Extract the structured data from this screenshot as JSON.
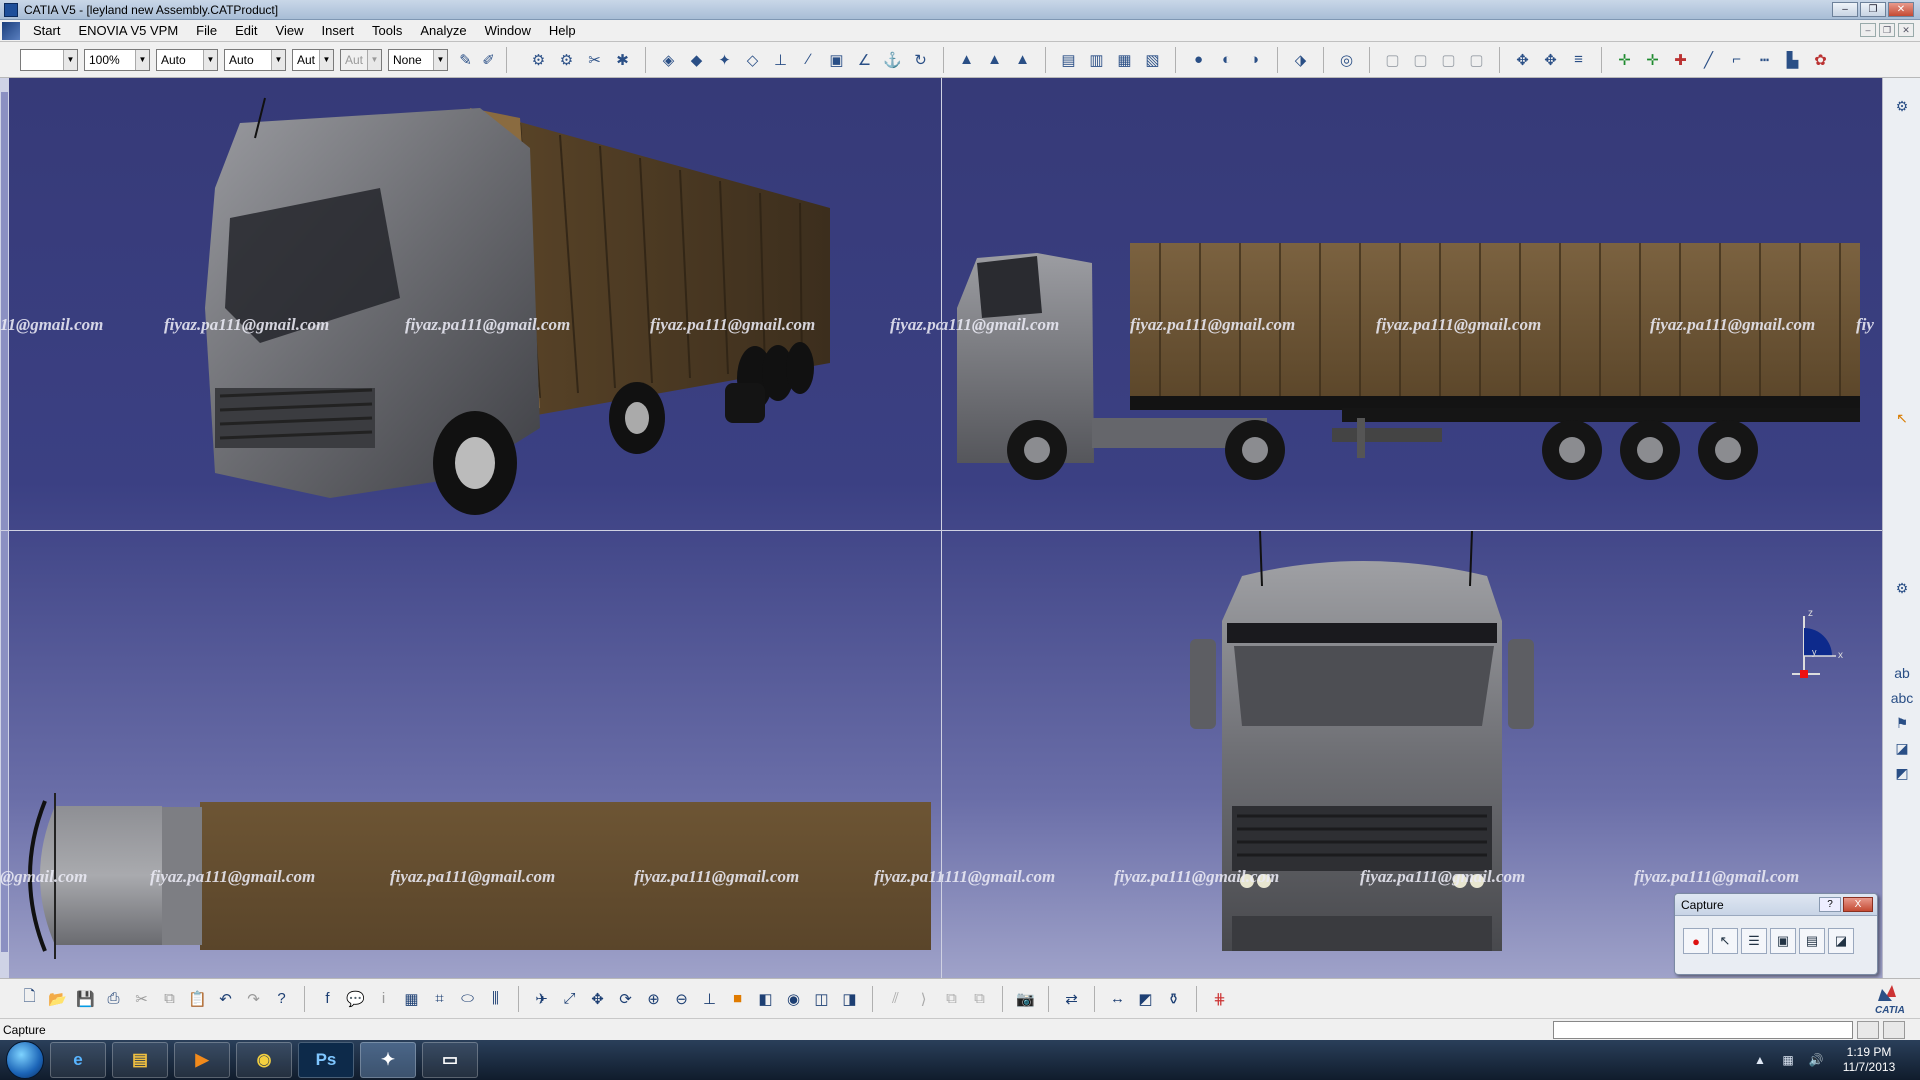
{
  "window": {
    "title": "CATIA V5 - [leyland new Assembly.CATProduct]"
  },
  "menu": {
    "items": [
      {
        "label": "Start"
      },
      {
        "label": "ENOVIA V5 VPM"
      },
      {
        "label": "File"
      },
      {
        "label": "Edit"
      },
      {
        "label": "View"
      },
      {
        "label": "Insert"
      },
      {
        "label": "Tools"
      },
      {
        "label": "Analyze"
      },
      {
        "label": "Window"
      },
      {
        "label": "Help"
      }
    ]
  },
  "toolbar": {
    "combos": [
      {
        "value": ""
      },
      {
        "value": "100%"
      },
      {
        "value": "Auto"
      },
      {
        "value": "Auto"
      },
      {
        "value": "Aut"
      },
      {
        "value": "Aut"
      },
      {
        "value": "None"
      }
    ]
  },
  "viewport": {
    "watermark": "fiyaz.pa111@gmail.com",
    "watermark_partial_left_top": "11@gmail.com",
    "watermark_partial_left_bottom": "@gmail.com",
    "watermark_partial_right_top": "fiy",
    "colors": {
      "background_top": "#363a78",
      "background_bottom": "#9fa2c9",
      "truck_body": "#6e6f74",
      "container": "#6a5435"
    }
  },
  "capture_dialog": {
    "title": "Capture",
    "help_label": "?",
    "close_label": "X"
  },
  "compass": {
    "z_label": "z",
    "y_label": "y",
    "x_label": "x"
  },
  "status": {
    "text": "Capture"
  },
  "taskbar": {
    "photoshop_label": "Ps",
    "clock_time": "1:19 PM",
    "clock_date": "11/7/2013"
  },
  "branding": {
    "catia_logo_text": "CATIA"
  }
}
